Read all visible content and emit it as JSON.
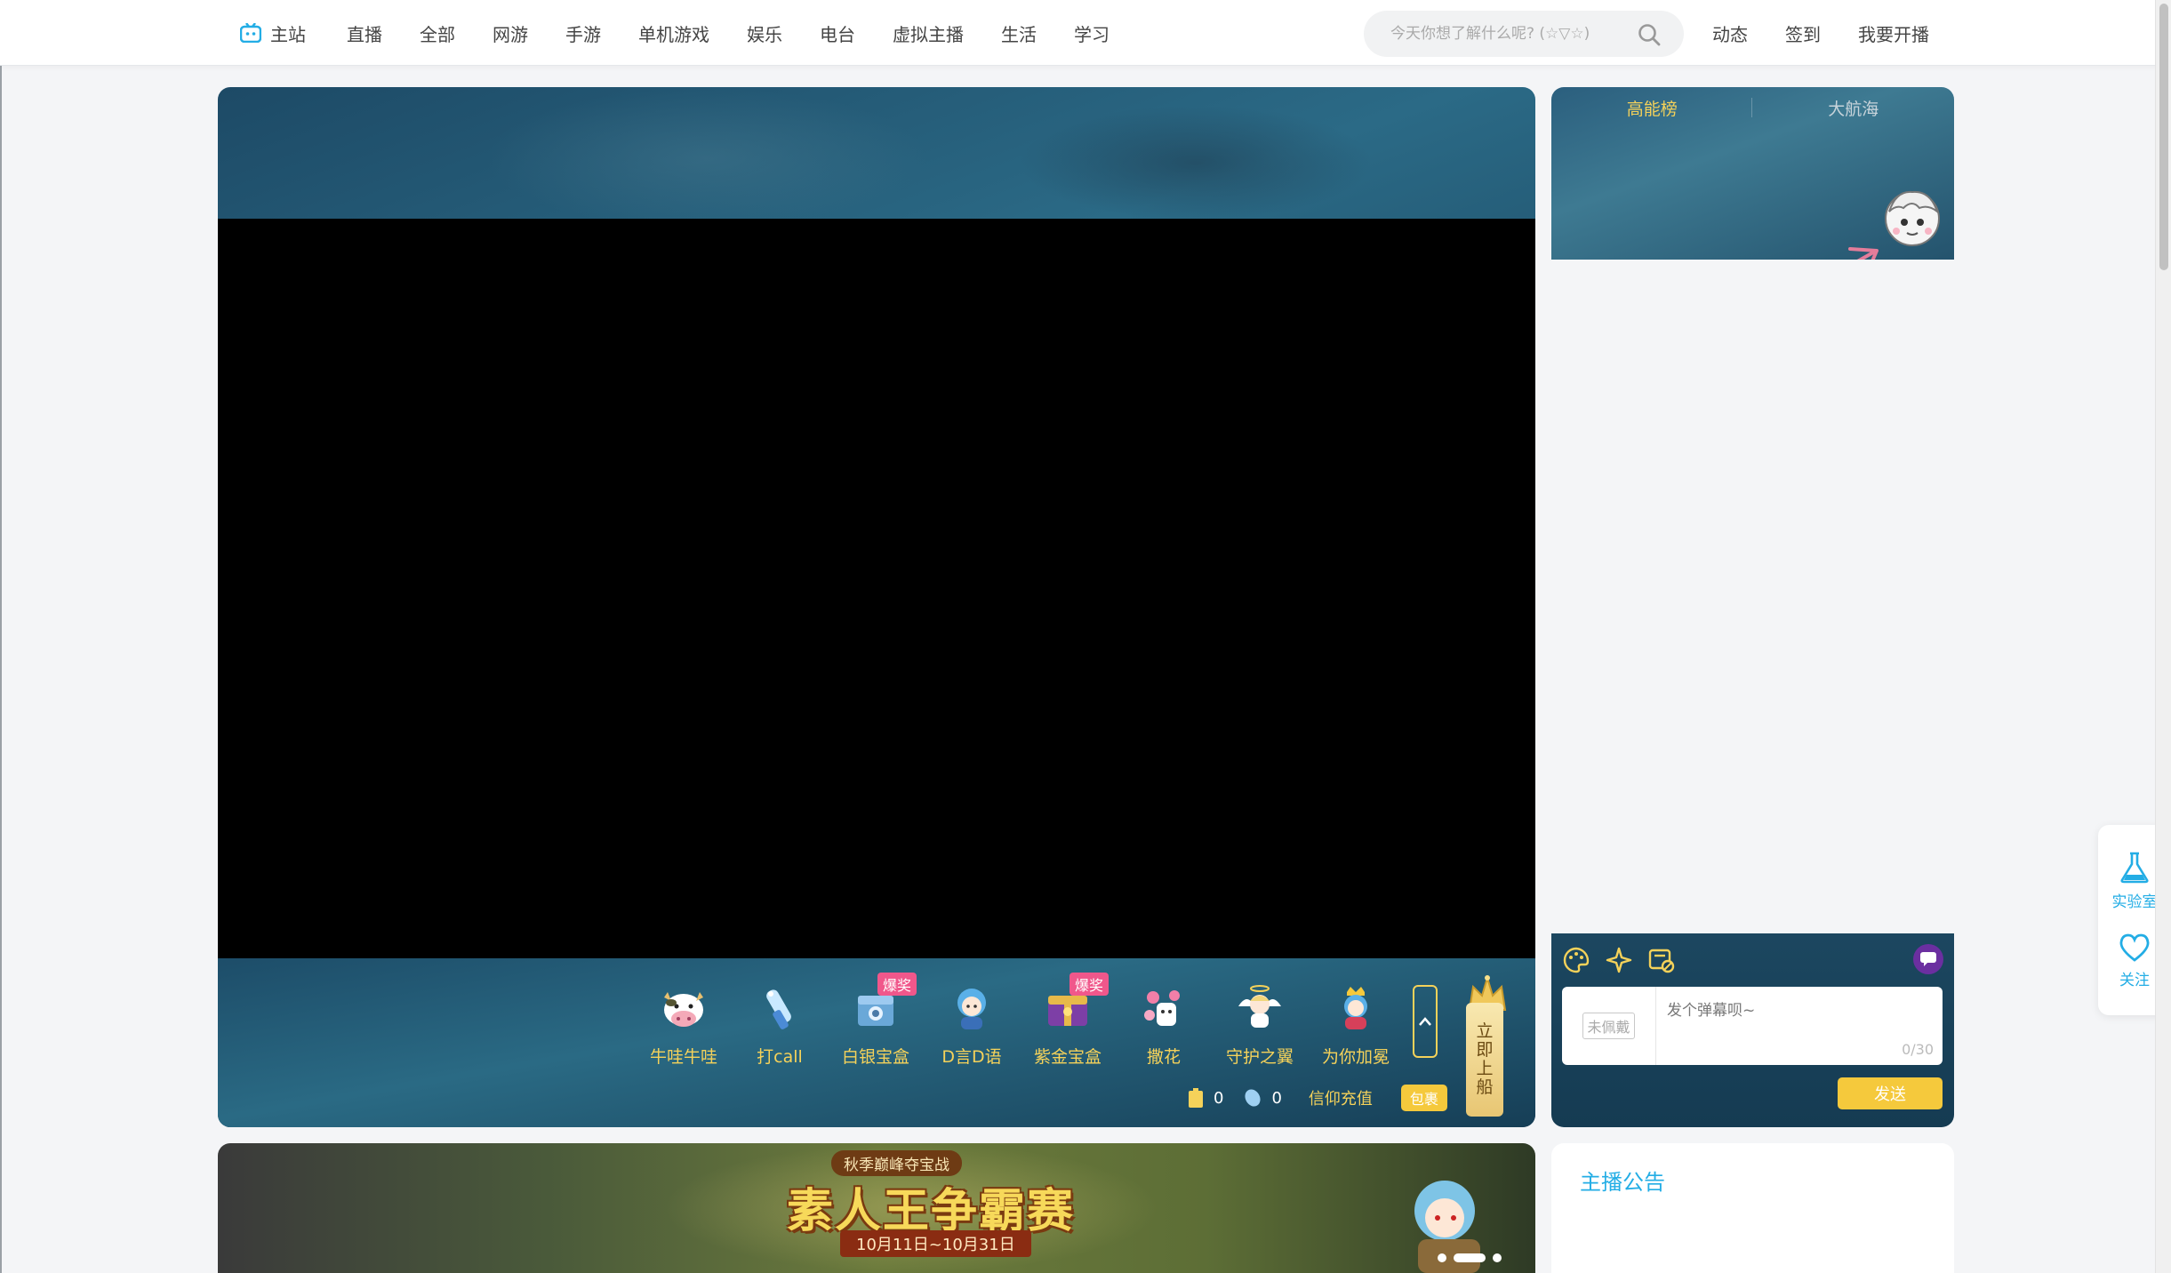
{
  "nav": {
    "home": "主站",
    "items": [
      "直播",
      "全部",
      "网游",
      "手游",
      "单机游戏",
      "娱乐",
      "电台",
      "虚拟主播",
      "生活",
      "学习"
    ]
  },
  "search": {
    "placeholder": "今天你想了解什么呢? (☆▽☆)"
  },
  "right_links": [
    "动态",
    "签到",
    "我要开播"
  ],
  "gifts": [
    {
      "name": "牛哇牛哇",
      "icon": "cow-icon"
    },
    {
      "name": "打call",
      "icon": "glowstick-icon"
    },
    {
      "name": "白银宝盒",
      "icon": "silver-box-icon",
      "badge": "爆奖"
    },
    {
      "name": "D言D语",
      "icon": "chibi-icon"
    },
    {
      "name": "紫金宝盒",
      "icon": "purple-box-icon",
      "badge": "爆奖"
    },
    {
      "name": "撒花",
      "icon": "flower-icon"
    },
    {
      "name": "守护之翼",
      "icon": "angel-icon"
    },
    {
      "name": "为你加冕",
      "icon": "crown-girl-icon"
    }
  ],
  "ship": {
    "label": [
      "立",
      "即",
      "上",
      "船"
    ]
  },
  "wallet": {
    "gold": "0",
    "silver": "0",
    "recharge": "信仰充值",
    "pack": "包裹"
  },
  "rank": {
    "tabs": [
      "高能榜",
      "大航海"
    ]
  },
  "chat": {
    "medal": "未佩戴",
    "placeholder": "发个弹幕呗~",
    "count": "0/30",
    "send": "发送"
  },
  "banner": {
    "sub": "秋季巅峰夺宝战",
    "title": "素人王争霸赛",
    "date": "10月11日~10月31日"
  },
  "notice": {
    "title": "主播公告"
  },
  "side": {
    "lab": "实验室",
    "follow": "关注"
  },
  "colors": {
    "accent": "#23ade5",
    "gold": "#f5d25a",
    "pink_badge": "#f0578b"
  }
}
